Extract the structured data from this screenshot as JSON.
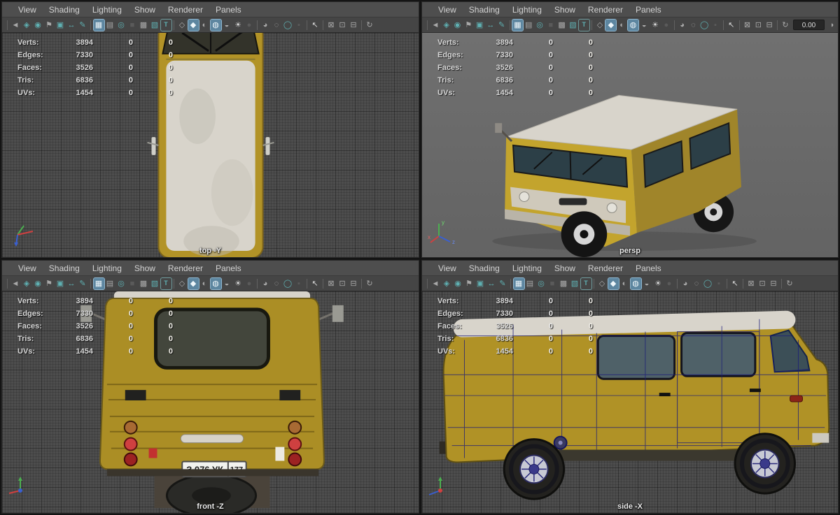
{
  "app": {
    "name": "maya-four-view-layout"
  },
  "menus": [
    "View",
    "Shading",
    "Lighting",
    "Show",
    "Renderer",
    "Panels"
  ],
  "toolbar": {
    "icons": [
      {
        "n": "select-camera-icon",
        "g": "◄",
        "c": "gray"
      },
      {
        "n": "lock-camera-icon",
        "g": "◈",
        "c": "teal"
      },
      {
        "n": "camera-attributes-icon",
        "g": "◉",
        "c": "teal"
      },
      {
        "n": "bookmark-icon",
        "g": "⚑",
        "c": "gray"
      },
      {
        "n": "image-plane-icon",
        "g": "▣",
        "c": "teal"
      },
      {
        "n": "pan-zoom-icon",
        "g": "↔",
        "c": "teal"
      },
      {
        "n": "grease-pencil-icon",
        "g": "✎",
        "c": "teal",
        "sep": true
      },
      {
        "n": "grid-icon",
        "g": "▦",
        "c": "light",
        "active": true
      },
      {
        "n": "film-gate-icon",
        "g": "▤",
        "c": "gray"
      },
      {
        "n": "resolution-gate-icon",
        "g": "◎",
        "c": "teal"
      },
      {
        "n": "gate-mask-icon",
        "g": "■",
        "c": "dark"
      },
      {
        "n": "field-chart-icon",
        "g": "▩",
        "c": "gray"
      },
      {
        "n": "safe-action-icon",
        "g": "▧",
        "c": "teal"
      },
      {
        "n": "safe-title-icon",
        "g": "T",
        "c": "teal",
        "boxed": true,
        "sep": true
      },
      {
        "n": "wireframe-icon",
        "g": "◇",
        "c": "gray"
      },
      {
        "n": "shaded-icon",
        "g": "◆",
        "c": "teal",
        "active": true
      },
      {
        "n": "wireframe-on-shaded-icon",
        "g": "◐",
        "c": "gray"
      },
      {
        "n": "textured-icon",
        "g": "◍",
        "c": "teal",
        "active": true
      },
      {
        "n": "use-default-material-icon",
        "g": "◒",
        "c": "gray"
      },
      {
        "n": "lighting-icon",
        "g": "☀",
        "c": "light"
      },
      {
        "n": "shadows-icon",
        "g": "●",
        "c": "dark",
        "sep": true
      },
      {
        "n": "occlusion-icon",
        "g": "◕",
        "c": "gray"
      },
      {
        "n": "motion-blur-icon",
        "g": "◌",
        "c": "gray"
      },
      {
        "n": "anti-alias-icon",
        "g": "◯",
        "c": "teal"
      },
      {
        "n": "depth-of-field-icon",
        "g": "▪",
        "c": "dark",
        "sep": true
      },
      {
        "n": "isolate-select-icon",
        "g": "↖",
        "c": "light",
        "sep": true
      },
      {
        "n": "xray-icon",
        "g": "⊠",
        "c": "gray"
      },
      {
        "n": "xray-joints-icon",
        "g": "⊡",
        "c": "gray"
      },
      {
        "n": "screen-space-icon",
        "g": "⊟",
        "c": "gray",
        "sep": true
      },
      {
        "n": "exposure-icon",
        "g": "↻",
        "c": "gray"
      }
    ],
    "view_transform_glyph": "◗"
  },
  "hud": {
    "rows": [
      {
        "label": "Verts:",
        "total": "3894",
        "sel": "0",
        "comp": "0"
      },
      {
        "label": "Edges:",
        "total": "7330",
        "sel": "0",
        "comp": "0"
      },
      {
        "label": "Faces:",
        "total": "3526",
        "sel": "0",
        "comp": "0"
      },
      {
        "label": "Tris:",
        "total": "6836",
        "sel": "0",
        "comp": "0"
      },
      {
        "label": "UVs:",
        "total": "1454",
        "sel": "0",
        "comp": "0"
      }
    ]
  },
  "panels": [
    {
      "label": "top -Y",
      "camera": "top"
    },
    {
      "label": "persp",
      "camera": "persp",
      "exposure": "0.00"
    },
    {
      "label": "front -Z",
      "camera": "front"
    },
    {
      "label": "side -X",
      "camera": "side"
    }
  ],
  "front_view": {
    "plate": "З 076 УК",
    "plate_region": "177"
  },
  "axis": {
    "x": "x",
    "y": "y",
    "z": "z"
  },
  "colors": {
    "active_button_bg": "#5d86a0",
    "icon_teal": "#5fb0b2",
    "van_body_yellow": "#b29327",
    "van_roof_white": "#d8d4cb",
    "wireframe_blue": "#1b1b7a",
    "taillight_red": "#cf4040",
    "viewport_grid_gray": "#4d4d4d",
    "persp_bg_gray": "#6a6a6a"
  }
}
